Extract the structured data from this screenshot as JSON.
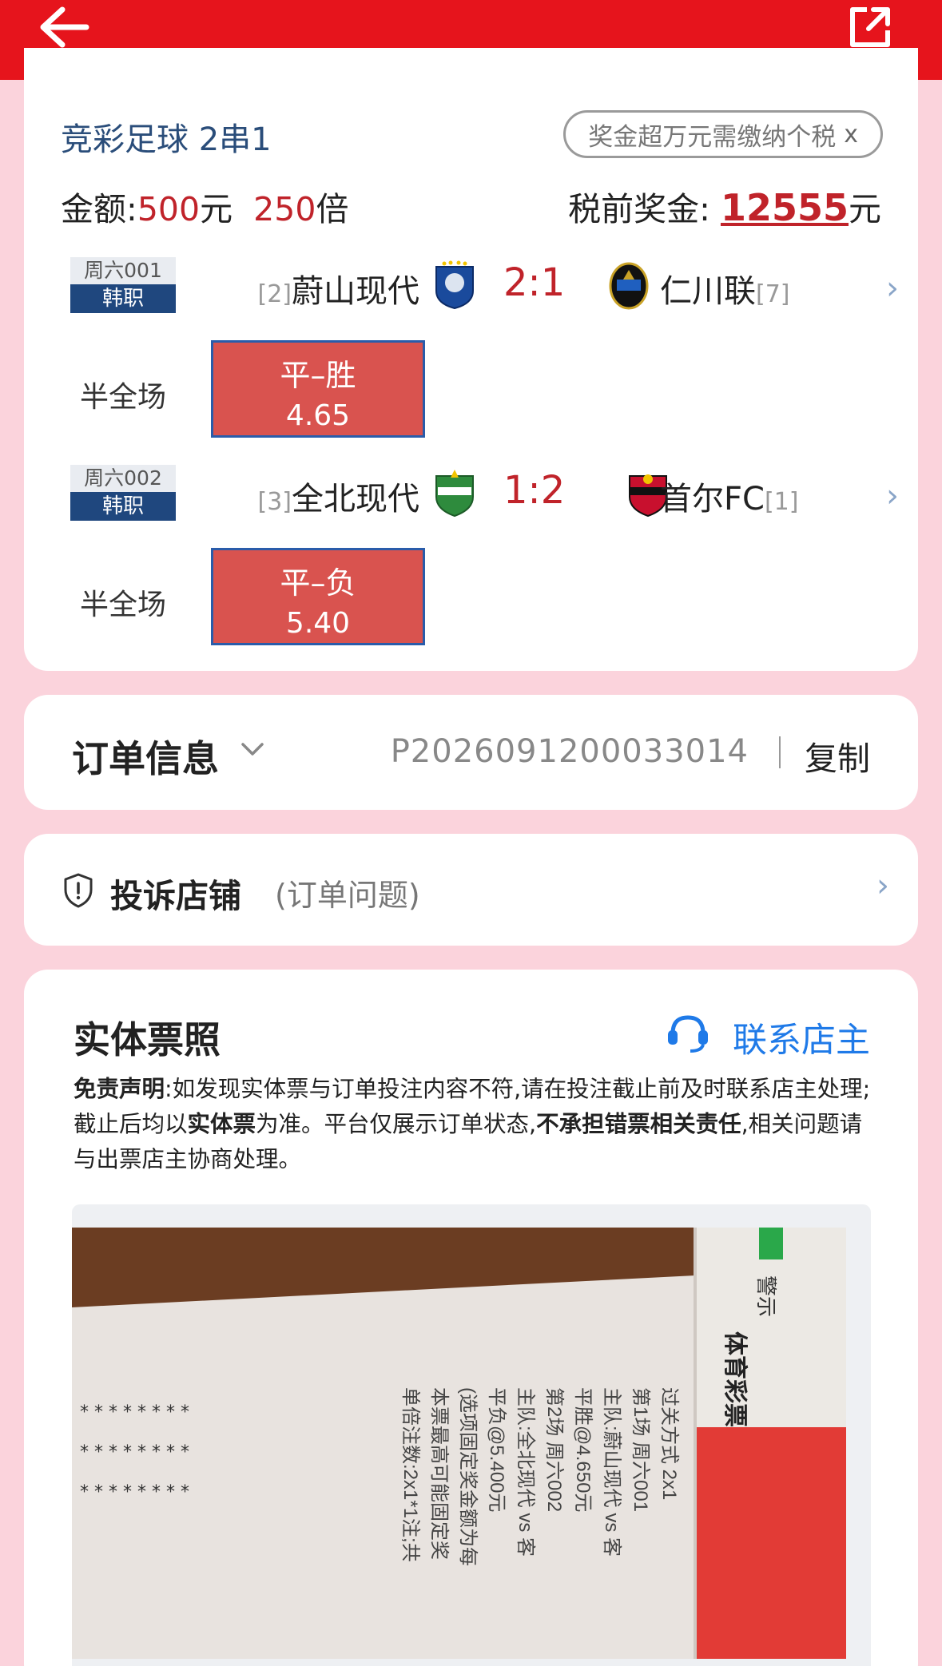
{
  "colors": {
    "topbar": "#e6141c",
    "accent_red": "#c0232a",
    "badge_blue": "#1f477e",
    "link_blue": "#1f7ae8",
    "page_bg": "#fbd3dc"
  },
  "topbar": {
    "back_icon": "back-arrow-icon",
    "share_icon": "share-icon"
  },
  "bet": {
    "play_type": "竞彩足球 2串1",
    "tax_notice": "奖金超万元需缴纳个税",
    "tax_close": "x",
    "amount_label": "金额:",
    "amount_value": "500",
    "amount_unit": "元",
    "multiple_value": "250",
    "multiple_unit": "倍",
    "prize_label": "税前奖金:",
    "prize_value": "12555",
    "prize_unit": "元"
  },
  "matches": [
    {
      "day": "周六001",
      "league": "韩职",
      "home_rank": "[2]",
      "home": "蔚山现代",
      "score": "2:1",
      "away": "仁川联",
      "away_rank": "[7]",
      "pick_label": "半全场",
      "pick": "平–胜",
      "odds": "4.65"
    },
    {
      "day": "周六002",
      "league": "韩职",
      "home_rank": "[3]",
      "home": "全北现代",
      "score": "1:2",
      "away": "首尔FC",
      "away_rank": "[1]",
      "pick_label": "半全场",
      "pick": "平–负",
      "odds": "5.40"
    }
  ],
  "order": {
    "title": "订单信息",
    "number": "P2026091200033014",
    "copy": "复制"
  },
  "complaint": {
    "title": "投诉店铺",
    "subtitle": "(订单问题)"
  },
  "ticket": {
    "title": "实体票照",
    "contact": "联系店主",
    "disclaimer_b1": "免责声明",
    "disclaimer_t1": ":如发现实体票与订单投注内容不符,请在投注截止前及时联系店主处理;截止后均以",
    "disclaimer_b2": "实体票",
    "disclaimer_t2": "为准。平台仅展示订单状态,",
    "disclaimer_b3": "不承担错票相关责任",
    "disclaimer_t3": ",相关问题请与出票店主协商处理。",
    "photo_lines": [
      "过关方式 2x1",
      "第1场 周六001",
      "主队:蔚山现代 vs 客",
      "平胜@4.650元",
      "第2场 周六002",
      "主队:全北现代 vs 客",
      "平负@5.400元",
      "(选项固定奖金额为每",
      "本票最高可能固定奖",
      "单倍注数:2x1*1注;共"
    ],
    "photo_side": "体育彩票",
    "photo_side2": "警示"
  }
}
